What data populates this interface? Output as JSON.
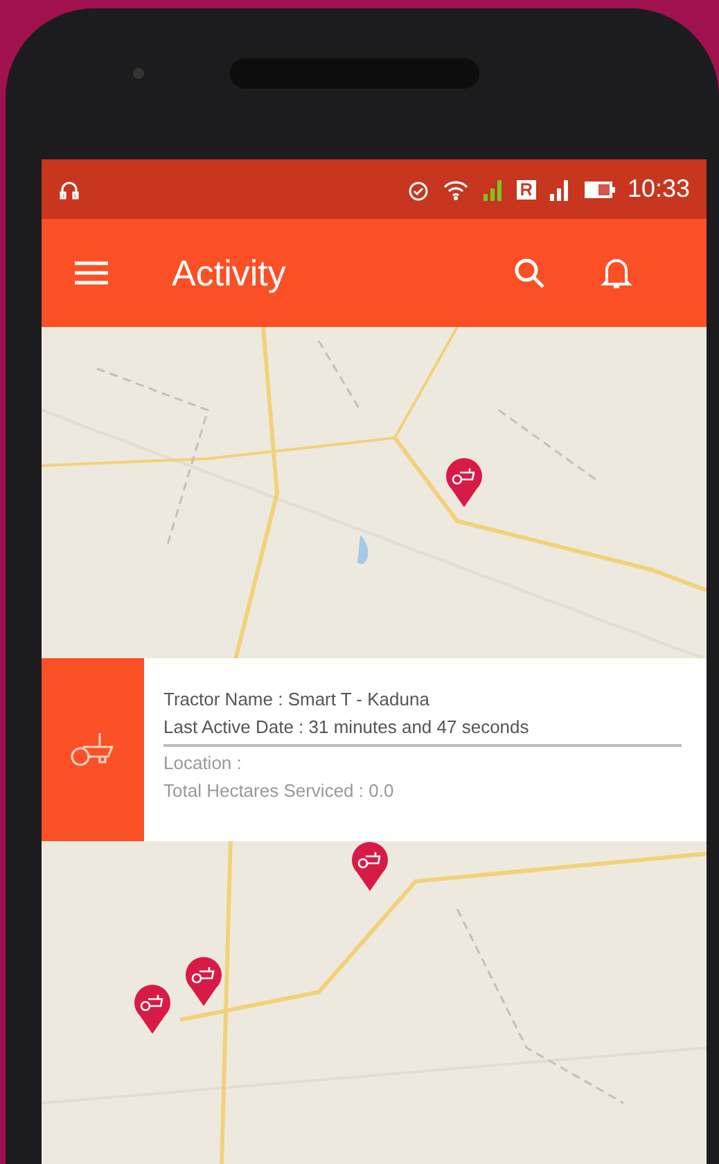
{
  "status_bar": {
    "time": "10:33"
  },
  "app_bar": {
    "title": "Activity"
  },
  "info_card": {
    "primary_lines": [
      "Tractor Name : Smart T - Kaduna",
      "Last Active Date : 31 minutes and 47 seconds"
    ],
    "secondary_lines": [
      "Location :",
      "Total Hectares Serviced : 0.0"
    ]
  }
}
